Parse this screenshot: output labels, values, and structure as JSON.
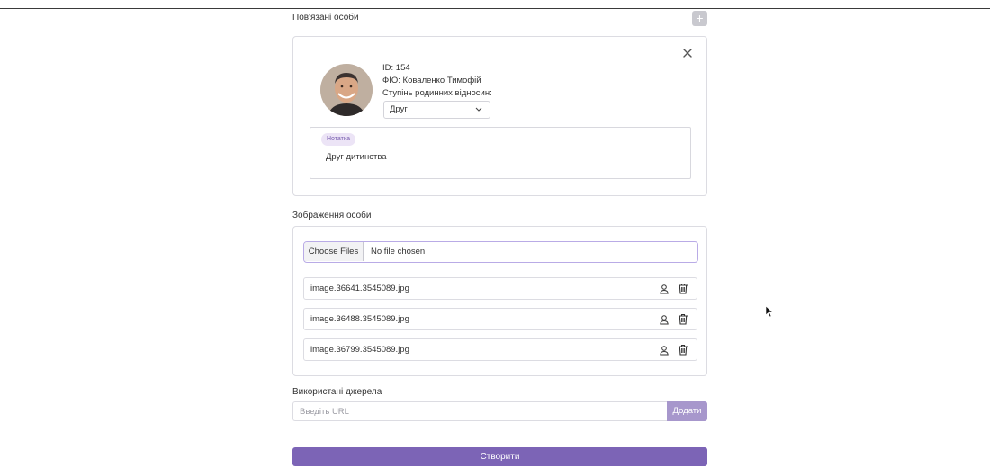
{
  "related_persons": {
    "title": "Пов'язані особи",
    "add_icon": "plus-icon",
    "person": {
      "id_label": "ID:",
      "id_value": "154",
      "name_label": "ФІО:",
      "name_value": "Коваленко Тимофій",
      "relation_label": "Ступінь родинних відносин:",
      "relation_value": "Друг",
      "close_icon": "close-icon",
      "note_badge": "Нотатка",
      "note_text": "Друг дитинства"
    }
  },
  "images": {
    "title": "Зображення особи",
    "choose_files_label": "Choose Files",
    "no_file_label": "No file chosen",
    "files": [
      {
        "name": "image.36641.3545089.jpg"
      },
      {
        "name": "image.36488.3545089.jpg"
      },
      {
        "name": "image.36799.3545089.jpg"
      }
    ]
  },
  "sources": {
    "title": "Використані джерела",
    "url_placeholder": "Введіть URL",
    "add_label": "Додати"
  },
  "submit": {
    "label": "Створити"
  },
  "colors": {
    "accent": "#7c64b6",
    "accent_light": "#a797cc",
    "badge_bg": "#ece4f6",
    "focus_border": "#b9abe6"
  }
}
